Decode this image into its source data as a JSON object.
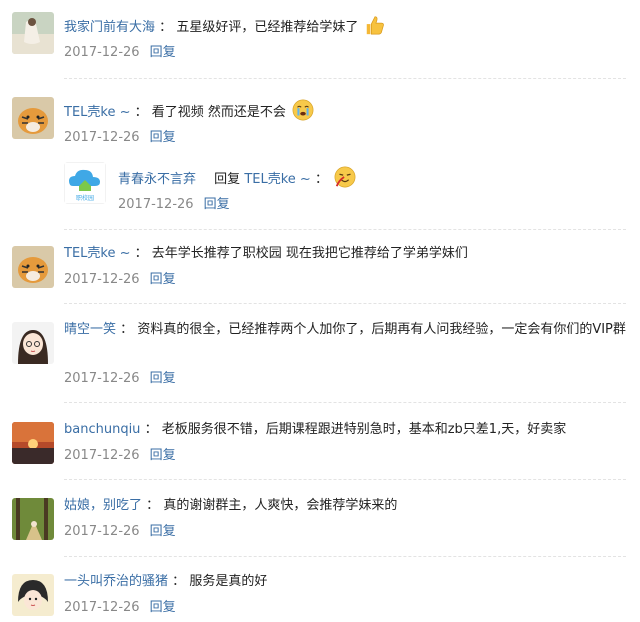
{
  "comments": [
    {
      "user": "我家门前有大海",
      "sep": "：",
      "text": "五星级好评，已经推荐给学妹了",
      "date": "2017-12-26",
      "reply": "回复"
    },
    {
      "user": "TEL壳ke ~",
      "sep": "：",
      "text": "看了视频 然而还是不会",
      "date": "2017-12-26",
      "reply": "回复"
    },
    {
      "user": "TEL壳ke ~",
      "sep": "：",
      "text": "去年学长推荐了职校园 现在我把它推荐给了学弟学妹们",
      "date": "2017-12-26",
      "reply": "回复"
    },
    {
      "user": "晴空一笑",
      "sep": "：",
      "text": "资料真的很全，已经推荐两个人加你了，后期再有人问我经验，一定会有你们的VIP群",
      "date": "2017-12-26",
      "reply": "回复"
    },
    {
      "user": "banchunqiu",
      "sep": "：",
      "text": "老板服务很不错，后期课程跟进特别急时，基本和zb只差1,天，好卖家",
      "date": "2017-12-26",
      "reply": "回复"
    },
    {
      "user": "姑娘，别吃了",
      "sep": "：",
      "text": "真的谢谢群主，人爽快，会推荐学妹来的",
      "date": "2017-12-26",
      "reply": "回复"
    },
    {
      "user": "一头叫乔治的骚猪",
      "sep": "：",
      "text": "服务是真的好",
      "date": "2017-12-26",
      "reply": "回复"
    }
  ],
  "subreply": {
    "user": "青春永不言弃",
    "replyword": "回复",
    "target": "TEL壳ke ~",
    "sep": "：",
    "date": "2017-12-26",
    "reply": "回复",
    "avatar_label": "职校园"
  },
  "colors": {
    "link": "#3a6ea5",
    "meta": "#888888",
    "divider": "#e3e3e3"
  },
  "icons": [
    "thumbs-up-emoji",
    "crying-emoji",
    "nosebleed-emoji",
    "tiger-avatar",
    "cloud-logo-avatar"
  ]
}
